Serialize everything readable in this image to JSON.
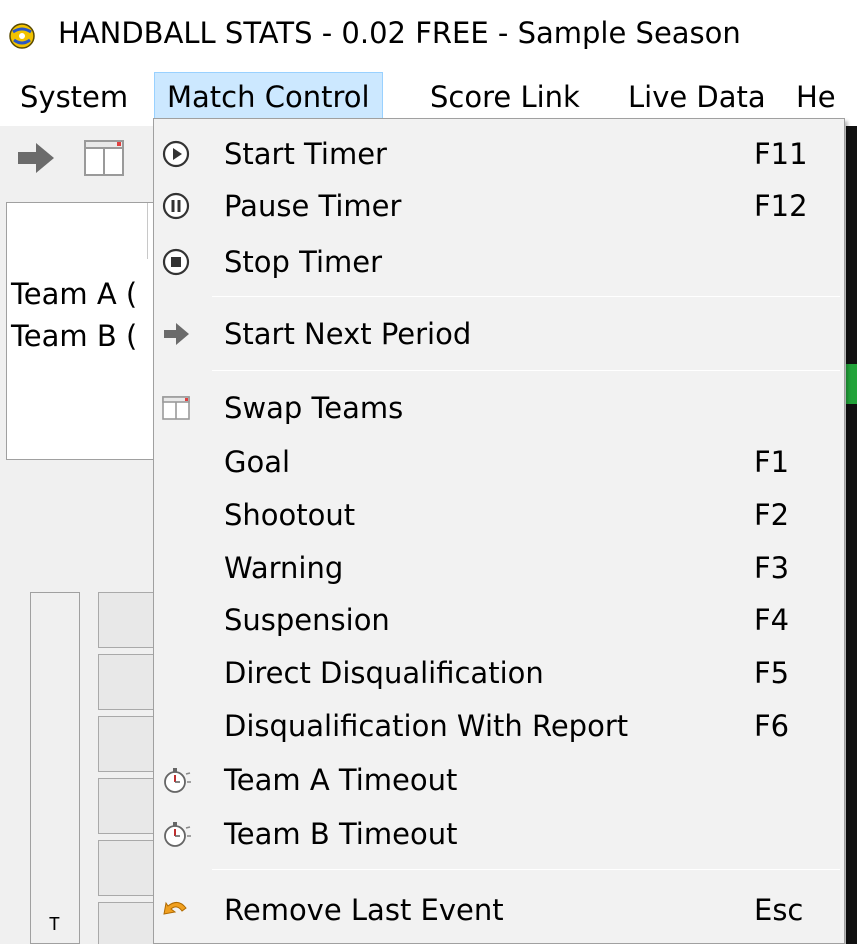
{
  "window": {
    "title": "HANDBALL STATS - 0.02 FREE - Sample Season"
  },
  "menubar": {
    "items": [
      {
        "label": "System"
      },
      {
        "label": "Match Control"
      },
      {
        "label": "Score Link"
      },
      {
        "label": "Live Data"
      },
      {
        "label": "He"
      }
    ]
  },
  "toolbar": {
    "buttons": [
      {
        "icon": "arrow-right-icon"
      },
      {
        "icon": "swap-panel-icon"
      }
    ]
  },
  "score_panel": {
    "team_a": "Team A (",
    "team_b": "Team B ("
  },
  "lower_left": {
    "label": "T"
  },
  "dropdown": {
    "items": [
      {
        "label": "Start Timer",
        "shortcut": "F11",
        "icon": "play-circle-icon"
      },
      {
        "label": "Pause Timer",
        "shortcut": "F12",
        "icon": "pause-circle-icon"
      },
      {
        "label": "Stop Timer",
        "shortcut": "",
        "icon": "stop-circle-icon"
      },
      {
        "label": "Start Next Period",
        "shortcut": "",
        "icon": "arrow-right-icon"
      },
      {
        "label": "Swap Teams",
        "shortcut": "",
        "icon": "swap-panel-icon"
      },
      {
        "label": "Goal",
        "shortcut": "F1",
        "icon": ""
      },
      {
        "label": "Shootout",
        "shortcut": "F2",
        "icon": ""
      },
      {
        "label": "Warning",
        "shortcut": "F3",
        "icon": ""
      },
      {
        "label": "Suspension",
        "shortcut": "F4",
        "icon": ""
      },
      {
        "label": "Direct Disqualification",
        "shortcut": "F5",
        "icon": ""
      },
      {
        "label": "Disqualification With Report",
        "shortcut": "F6",
        "icon": ""
      },
      {
        "label": "Team A Timeout",
        "shortcut": "",
        "icon": "stopwatch-icon"
      },
      {
        "label": "Team B Timeout",
        "shortcut": "",
        "icon": "stopwatch-icon"
      },
      {
        "label": "Remove Last Event",
        "shortcut": "Esc",
        "icon": "undo-icon"
      }
    ]
  },
  "colors": {
    "menu_highlight": "#cce8ff",
    "menu_highlight_border": "#99d1ff",
    "menu_bg": "#f2f2f2"
  }
}
